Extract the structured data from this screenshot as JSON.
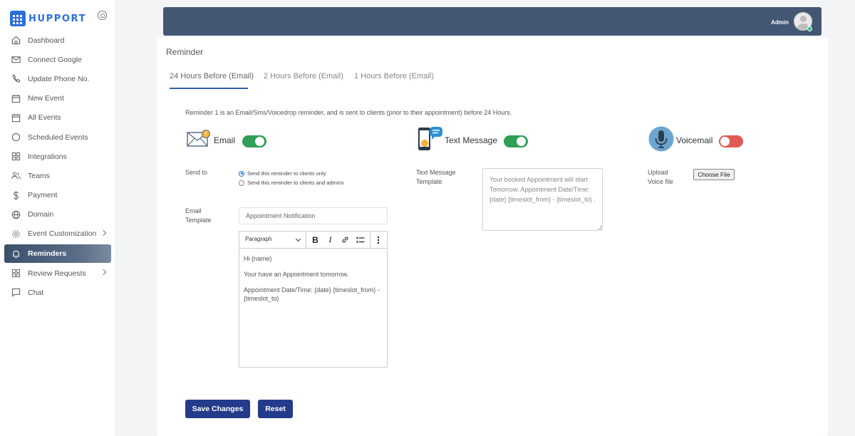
{
  "brand": {
    "name": "HUPPORT"
  },
  "sidebar": {
    "items": [
      {
        "label": "Dashboard",
        "icon": "home-icon"
      },
      {
        "label": "Connect Google",
        "icon": "mail-icon"
      },
      {
        "label": "Update Phone No.",
        "icon": "phone-icon"
      },
      {
        "label": "New Event",
        "icon": "calendar-icon"
      },
      {
        "label": "All Events",
        "icon": "calendar-icon"
      },
      {
        "label": "Scheduled Events",
        "icon": "circle-icon"
      },
      {
        "label": "Integrations",
        "icon": "grid-icon"
      },
      {
        "label": "Teams",
        "icon": "users-icon"
      },
      {
        "label": "Payment",
        "icon": "dollar-icon"
      },
      {
        "label": "Domain",
        "icon": "globe-icon"
      },
      {
        "label": "Event Customization",
        "icon": "gear-icon"
      },
      {
        "label": "Reminders",
        "icon": "bell-icon"
      },
      {
        "label": "Review Requests",
        "icon": "grid-icon"
      },
      {
        "label": "Chat",
        "icon": "chat-icon"
      }
    ]
  },
  "topbar": {
    "user_label": "Admin"
  },
  "main": {
    "title": "Reminder",
    "tabs": [
      {
        "label": "24 Hours Before (Email)"
      },
      {
        "label": "2 Hours Before (Email)"
      },
      {
        "label": "1 Hours Before (Email)"
      }
    ],
    "intro": "Reminder 1 is an Email/Sms/Voicedrop reminder, and is sent to clients (prior to their appointment) before 24 Hours.",
    "email": {
      "label": "Email",
      "enabled": true,
      "send_to_label": "Send to",
      "options": [
        "Send this reminder to clients only",
        "Send this reminder to clients and admins"
      ],
      "template_label_1": "Email",
      "template_label_2": "Template",
      "subject": "Appointment Notification",
      "toolbar_format": "Paragraph",
      "body": [
        "Hi {name}",
        "Your have an Appointment tomorrow.",
        "Appointment Date/Time: {date} {timeslot_from} - {timeslot_to}"
      ]
    },
    "sms": {
      "label": "Text Message",
      "enabled": true,
      "template_label_1": "Text Message",
      "template_label_2": "Template",
      "template_text": "Your booked Appointment will start Tomorrow. Appointment Date/Time: {date} {timeslot_from} - {timeslot_to} ."
    },
    "voicemail": {
      "label": "Voicemail",
      "enabled": false,
      "upload_label_1": "Upload",
      "upload_label_2": "Voice file",
      "file_button": "Choose File"
    },
    "actions": {
      "save": "Save Changes",
      "reset": "Reset"
    }
  },
  "colors": {
    "accent": "#243a8b",
    "topbar": "#435774",
    "toggle_on": "#2e9f54",
    "toggle_off": "#e25a55"
  }
}
